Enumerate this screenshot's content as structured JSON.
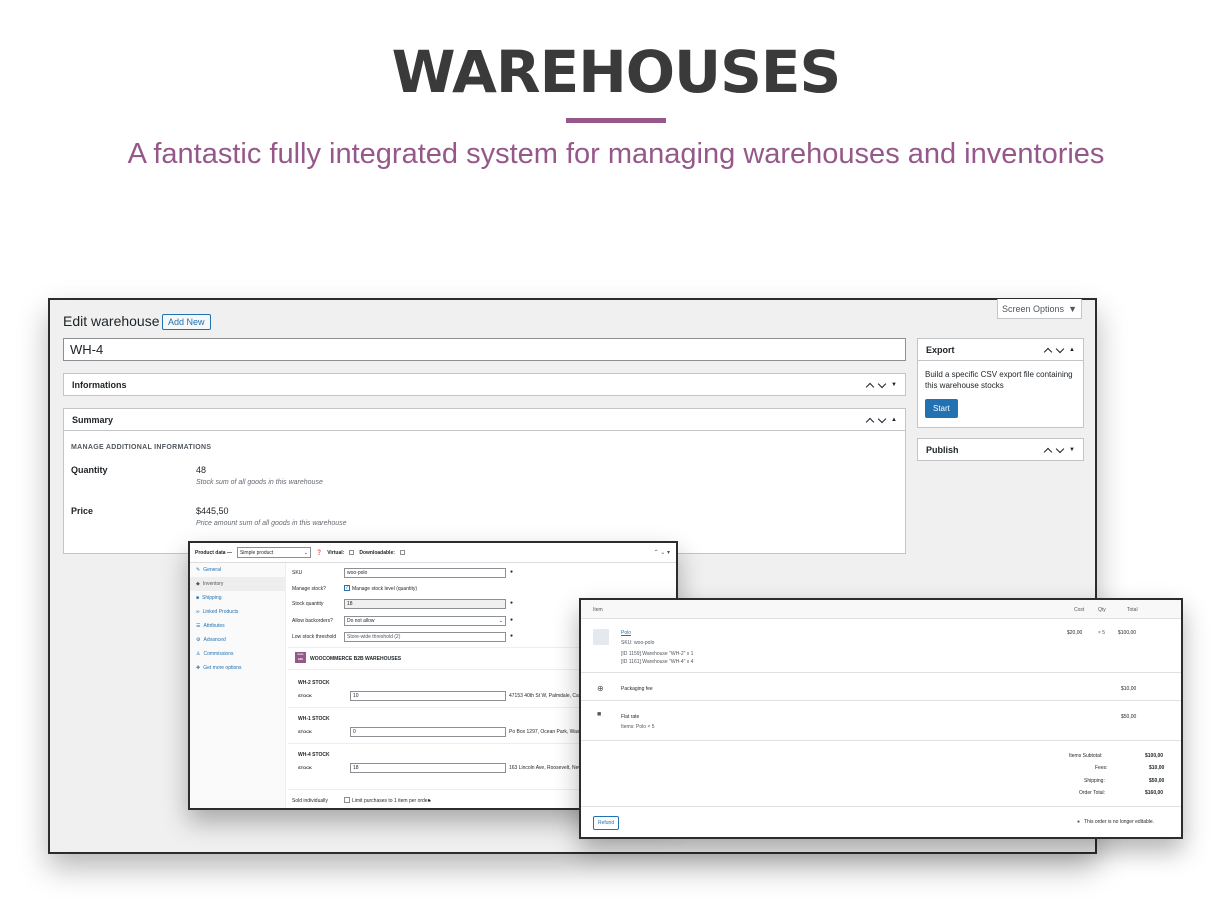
{
  "hero": {
    "title": "WAREHOUSES",
    "subtitle": "A fantastic fully integrated system for managing warehouses and inventories",
    "accent_color": "#96588a"
  },
  "edit": {
    "screen_options": "Screen Options",
    "page_title": "Edit warehouse",
    "add_new": "Add New",
    "warehouse_name": "WH-4",
    "informations_title": "Informations",
    "summary_title": "Summary",
    "summary_section": "MANAGE ADDITIONAL INFORMATIONS",
    "quantity_label": "Quantity",
    "quantity_value": "48",
    "quantity_desc": "Stock sum of all goods in this warehouse",
    "price_label": "Price",
    "price_value": "$445,50",
    "price_desc": "Price amount sum of all goods in this warehouse"
  },
  "export": {
    "title": "Export",
    "text": "Build a specific CSV export file containing this warehouse stocks",
    "start": "Start"
  },
  "publish": {
    "title": "Publish"
  },
  "product": {
    "label": "Product data —",
    "type": "Simple product",
    "virtual": "Virtual:",
    "downloadable": "Downloadable:",
    "tabs": [
      "General",
      "Inventory",
      "Shipping",
      "Linked Products",
      "Attributes",
      "Advanced",
      "Commissions",
      "Get more options"
    ],
    "sku_label": "SKU",
    "sku_value": "woo-polo",
    "manage_label": "Manage stock?",
    "manage_text": "Manage stock level (quantity)",
    "qty_label": "Stock quantity",
    "qty_value": "18",
    "backorders_label": "Allow backorders?",
    "backorders_value": "Do not allow",
    "threshold_label": "Low stock threshold",
    "threshold_value": "Store-wide threshold (2)",
    "plugin_title": "WOOCOMMERCE B2B WAREHOUSES",
    "plugin_badge": "woo b2b",
    "warehouses": [
      {
        "title": "WH-2 STOCK",
        "label": "STOCK",
        "value": "10",
        "address": "47153 40th St W, Palmdale, California"
      },
      {
        "title": "WH-1 STOCK",
        "label": "STOCK",
        "value": "0",
        "address": "Po Box 1297, Ocean Park, Washington"
      },
      {
        "title": "WH-4 STOCK",
        "label": "STOCK",
        "value": "18",
        "address": "163 Lincoln Ave, Roosevelt, New York"
      }
    ],
    "sold_label": "Sold individually",
    "sold_text": "Limit purchases to 1 item per order"
  },
  "order": {
    "col_item": "Item",
    "col_cost": "Cost",
    "col_qty": "Qty",
    "col_total": "Total",
    "item_name": "Polo",
    "item_sku": "SKU: woo-polo",
    "item_wh1": "[ID 1159] Warehouse \"WH-2\" x 1",
    "item_wh2": "[ID 1161] Warehouse \"WH-4\" x 4",
    "item_cost": "$20,00",
    "item_qty": "× 5",
    "item_total": "$100,00",
    "fee_name": "Packaging fee",
    "fee_total": "$10,00",
    "ship_name": "Flat rate",
    "ship_items": "Items: Polo × 5",
    "ship_total": "$50,00",
    "subtotal_label": "Items Subtotal:",
    "subtotal_value": "$100,00",
    "fees_label": "Fees:",
    "fees_value": "$10,00",
    "shipping_label": "Shipping:",
    "shipping_value": "$50,00",
    "total_label": "Order Total:",
    "total_value": "$160,00",
    "refund": "Refund",
    "not_editable": "This order is no longer editable."
  }
}
